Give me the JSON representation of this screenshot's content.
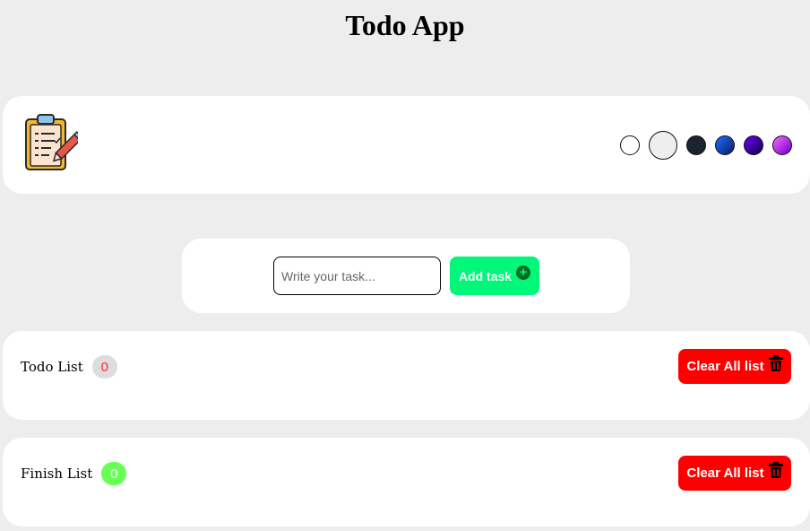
{
  "app": {
    "title": "Todo App"
  },
  "header": {
    "logo_icon": "clipboard-checklist-pencil-icon",
    "themes": [
      {
        "name": "white",
        "colors": [
          "#ffffff",
          "#ffffff"
        ],
        "selected": false
      },
      {
        "name": "light",
        "colors": [
          "#eeeeee",
          "#eeeeee"
        ],
        "selected": true
      },
      {
        "name": "dark",
        "colors": [
          "#1a2330",
          "#1a2330"
        ],
        "selected": false
      },
      {
        "name": "blue-gradient",
        "colors": [
          "#1e6fff",
          "#0a1a66"
        ],
        "selected": false
      },
      {
        "name": "purple-gradient",
        "colors": [
          "#6a00ff",
          "#120044"
        ],
        "selected": false
      },
      {
        "name": "pink-gradient",
        "colors": [
          "#ff66ff",
          "#6600cc"
        ],
        "selected": false
      }
    ]
  },
  "task_form": {
    "placeholder": "Write your task...",
    "value": "",
    "add_label": "Add task",
    "add_icon": "plus-circle-icon"
  },
  "todo_list": {
    "title": "Todo List",
    "count": "0",
    "count_color": "#ff2a2a",
    "badge_bg": "#dddddd",
    "clear_label": "Clear All list",
    "clear_icon": "trash-icon"
  },
  "finish_list": {
    "title": "Finish List",
    "count": "0",
    "count_color": "#ffffff",
    "badge_bg": "#66ff55",
    "clear_label": "Clear All list",
    "clear_icon": "trash-icon"
  },
  "colors": {
    "background": "#ededed",
    "card": "#ffffff",
    "add_button": "#00f77a",
    "clear_button": "#ff0000"
  }
}
